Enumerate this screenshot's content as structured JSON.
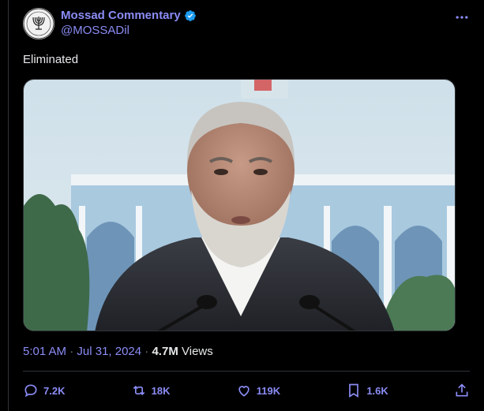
{
  "author": {
    "display_name": "Mossad Commentary",
    "handle": "@MOSSADil",
    "avatar_icon": "menorah-emblem-icon",
    "verified_icon": "verified-badge-icon"
  },
  "tweet": {
    "text": "Eliminated",
    "media_description": "photo"
  },
  "meta": {
    "time": "5:01 AM",
    "separator1": "·",
    "date": "Jul 31, 2024",
    "separator2": "·",
    "views_count": "4.7M",
    "views_label": "Views"
  },
  "actions": {
    "replies": "7.2K",
    "reposts": "18K",
    "likes": "119K",
    "bookmarks": "1.6K"
  },
  "colors": {
    "accent": "#8b8cf6",
    "verified": "#1d9bf0",
    "background": "#000000",
    "divider": "#2f3336"
  }
}
